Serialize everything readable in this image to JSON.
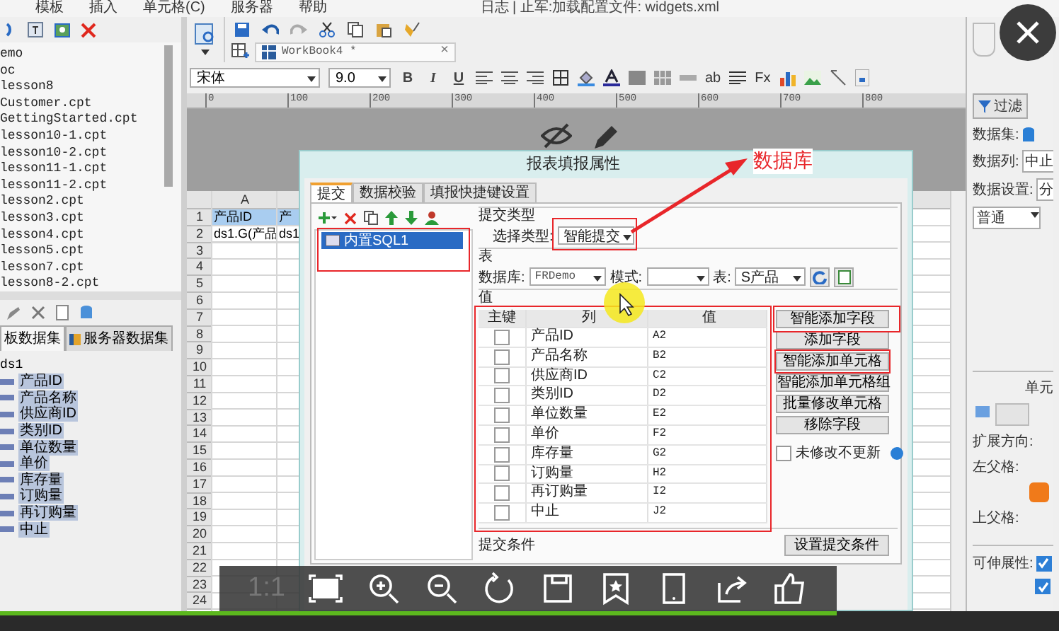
{
  "menu_bar": {
    "items": [
      "模板",
      "插入",
      "单元格(C)",
      "服务器",
      "帮助"
    ],
    "status": "日志 | 止军:加载配置文件: widgets.xml"
  },
  "template_tree": {
    "items": [
      "emo",
      "oc",
      "lesson8",
      "Customer.cpt",
      "GettingStarted.cpt",
      "lesson10-1.cpt",
      "lesson10-2.cpt",
      "lesson11-1.cpt",
      "lesson11-2.cpt",
      "lesson2.cpt",
      "lesson3.cpt",
      "lesson4.cpt",
      "lesson5.cpt",
      "lesson7.cpt",
      "lesson8-2.cpt"
    ]
  },
  "dataset_panel": {
    "tabs": [
      {
        "label": "板数据集",
        "selected": true
      },
      {
        "label": "服务器数据集",
        "selected": false
      }
    ],
    "dataset": "ds1",
    "fields": [
      {
        "label": "产品ID",
        "selected": true
      },
      {
        "label": "产品名称",
        "selected": true
      },
      {
        "label": "供应商ID",
        "selected": true
      },
      {
        "label": "类别ID",
        "selected": true
      },
      {
        "label": "单位数量",
        "selected": true
      },
      {
        "label": "单价",
        "selected": true
      },
      {
        "label": "库存量",
        "selected": true
      },
      {
        "label": "订购量",
        "selected": true
      },
      {
        "label": "再订购量",
        "selected": true
      },
      {
        "label": "中止",
        "selected": true
      }
    ]
  },
  "editor": {
    "workbook_tab": "WorkBook4 *",
    "tab_close": "×",
    "font": "宋体",
    "font_size": "9.0",
    "format_buttons": [
      "B",
      "I",
      "U"
    ],
    "text_buttons": [
      "ab",
      "Fx"
    ],
    "ruler": [
      "0",
      "100",
      "200",
      "300",
      "400",
      "500",
      "600",
      "700",
      "800"
    ],
    "columns": [
      "A"
    ],
    "rows": [
      "1",
      "2",
      "3",
      "4",
      "5",
      "6",
      "7",
      "8",
      "9",
      "10",
      "11",
      "12",
      "13",
      "14",
      "15",
      "16",
      "17",
      "18",
      "19",
      "20",
      "21",
      "22",
      "23",
      "24"
    ],
    "cells": [
      [
        "产品ID",
        "产"
      ],
      [
        "ds1.G(产品",
        "ds1"
      ]
    ]
  },
  "dialog": {
    "title": "报表填报属性",
    "tabs": [
      {
        "label": "提交",
        "selected": true
      },
      {
        "label": "数据校验",
        "selected": false
      },
      {
        "label": "填报快捷键设置",
        "selected": false
      }
    ],
    "submissions": [
      {
        "label": "内置SQL1",
        "selected": true
      }
    ],
    "submit_type": {
      "group": "提交类型",
      "label": "选择类型:",
      "value": "智能提交"
    },
    "table": {
      "group": "表",
      "database_label": "数据库:",
      "database": "FRDemo",
      "schema_label": "模式:",
      "table_label": "表:",
      "table": "S产品"
    },
    "values": {
      "group": "值",
      "columns": [
        "主键",
        "列",
        "值"
      ],
      "rows": [
        {
          "primary_key": false,
          "column": "产品ID",
          "value": "A2"
        },
        {
          "primary_key": false,
          "column": "产品名称",
          "value": "B2"
        },
        {
          "primary_key": false,
          "column": "供应商ID",
          "value": "C2"
        },
        {
          "primary_key": false,
          "column": "类别ID",
          "value": "D2"
        },
        {
          "primary_key": false,
          "column": "单位数量",
          "value": "E2"
        },
        {
          "primary_key": false,
          "column": "单价",
          "value": "F2"
        },
        {
          "primary_key": false,
          "column": "库存量",
          "value": "G2"
        },
        {
          "primary_key": false,
          "column": "订购量",
          "value": "H2"
        },
        {
          "primary_key": false,
          "column": "再订购量",
          "value": "I2"
        },
        {
          "primary_key": false,
          "column": "中止",
          "value": "J2"
        }
      ]
    },
    "buttons": [
      "智能添加字段",
      "添加字段",
      "智能添加单元格",
      "智能添加单元格组",
      "批量修改单元格",
      "移除字段"
    ],
    "no_update_unchanged": {
      "label": "未修改不更新",
      "checked": false
    },
    "condition": {
      "group": "提交条件",
      "button": "设置提交条件"
    }
  },
  "annotation": {
    "label": "数据库"
  },
  "right_panel": {
    "filter_button": "过滤",
    "dataset_label": "数据集:",
    "column_label": "数据列:",
    "column_value": "中止",
    "setting_label": "数据设置:",
    "setting_value": "分",
    "mode": "普通",
    "section_title": "单元",
    "expand_direction": "扩展方向:",
    "left_parent": "左父格:",
    "top_parent": "上父格:",
    "stretch_label": "可伸展性:",
    "stretch_checks": [
      {
        "checked": true
      },
      {
        "checked": true
      }
    ]
  },
  "player": {
    "zoom_label": "1:1",
    "progress": {
      "level": 0.79
    }
  }
}
